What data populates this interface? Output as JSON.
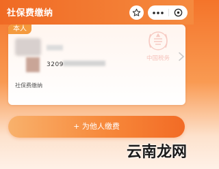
{
  "header": {
    "title": "社保费缴纳",
    "star_icon": "star-icon",
    "more_icon": "more-dots-icon",
    "close_icon": "close-circle-icon"
  },
  "card": {
    "tag": "本人",
    "id_partial": "3209",
    "label": "社保费缴纳",
    "emblem_text": "中国税务",
    "chevron_icon": "chevron-right-icon"
  },
  "actions": {
    "pay_for_others": "+ 为他人缴费"
  },
  "watermark": "云南龙网",
  "colors": {
    "accent": "#f4742a",
    "tag": "#f49a3e",
    "emblem": "#e25a4a"
  }
}
